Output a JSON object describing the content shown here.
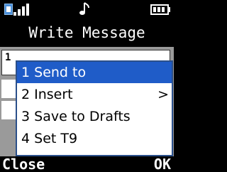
{
  "status_bar": {
    "sim_icon": "sim-card-icon",
    "signal_icon": "signal-strength-icon",
    "signal_bars": 4,
    "ringer_icon": "music-note-icon",
    "battery_icon": "battery-icon",
    "battery_level": "full"
  },
  "header": {
    "title": "Write Message"
  },
  "editor": {
    "cursor_char": "1"
  },
  "menu": {
    "selected_index": 0,
    "items": [
      {
        "label": "1 Send to",
        "submenu": false
      },
      {
        "label": "2 Insert",
        "submenu": true,
        "arrow": ">"
      },
      {
        "label": "3 Save to Drafts",
        "submenu": false
      },
      {
        "label": "4 Set T9",
        "submenu": false
      }
    ]
  },
  "softkeys": {
    "left": "Close",
    "right": "OK"
  },
  "colors": {
    "selection": "#1f5cc8",
    "menu_border": "#2a4f8a",
    "background": "#000000",
    "editor_background": "#9a9a9a"
  }
}
